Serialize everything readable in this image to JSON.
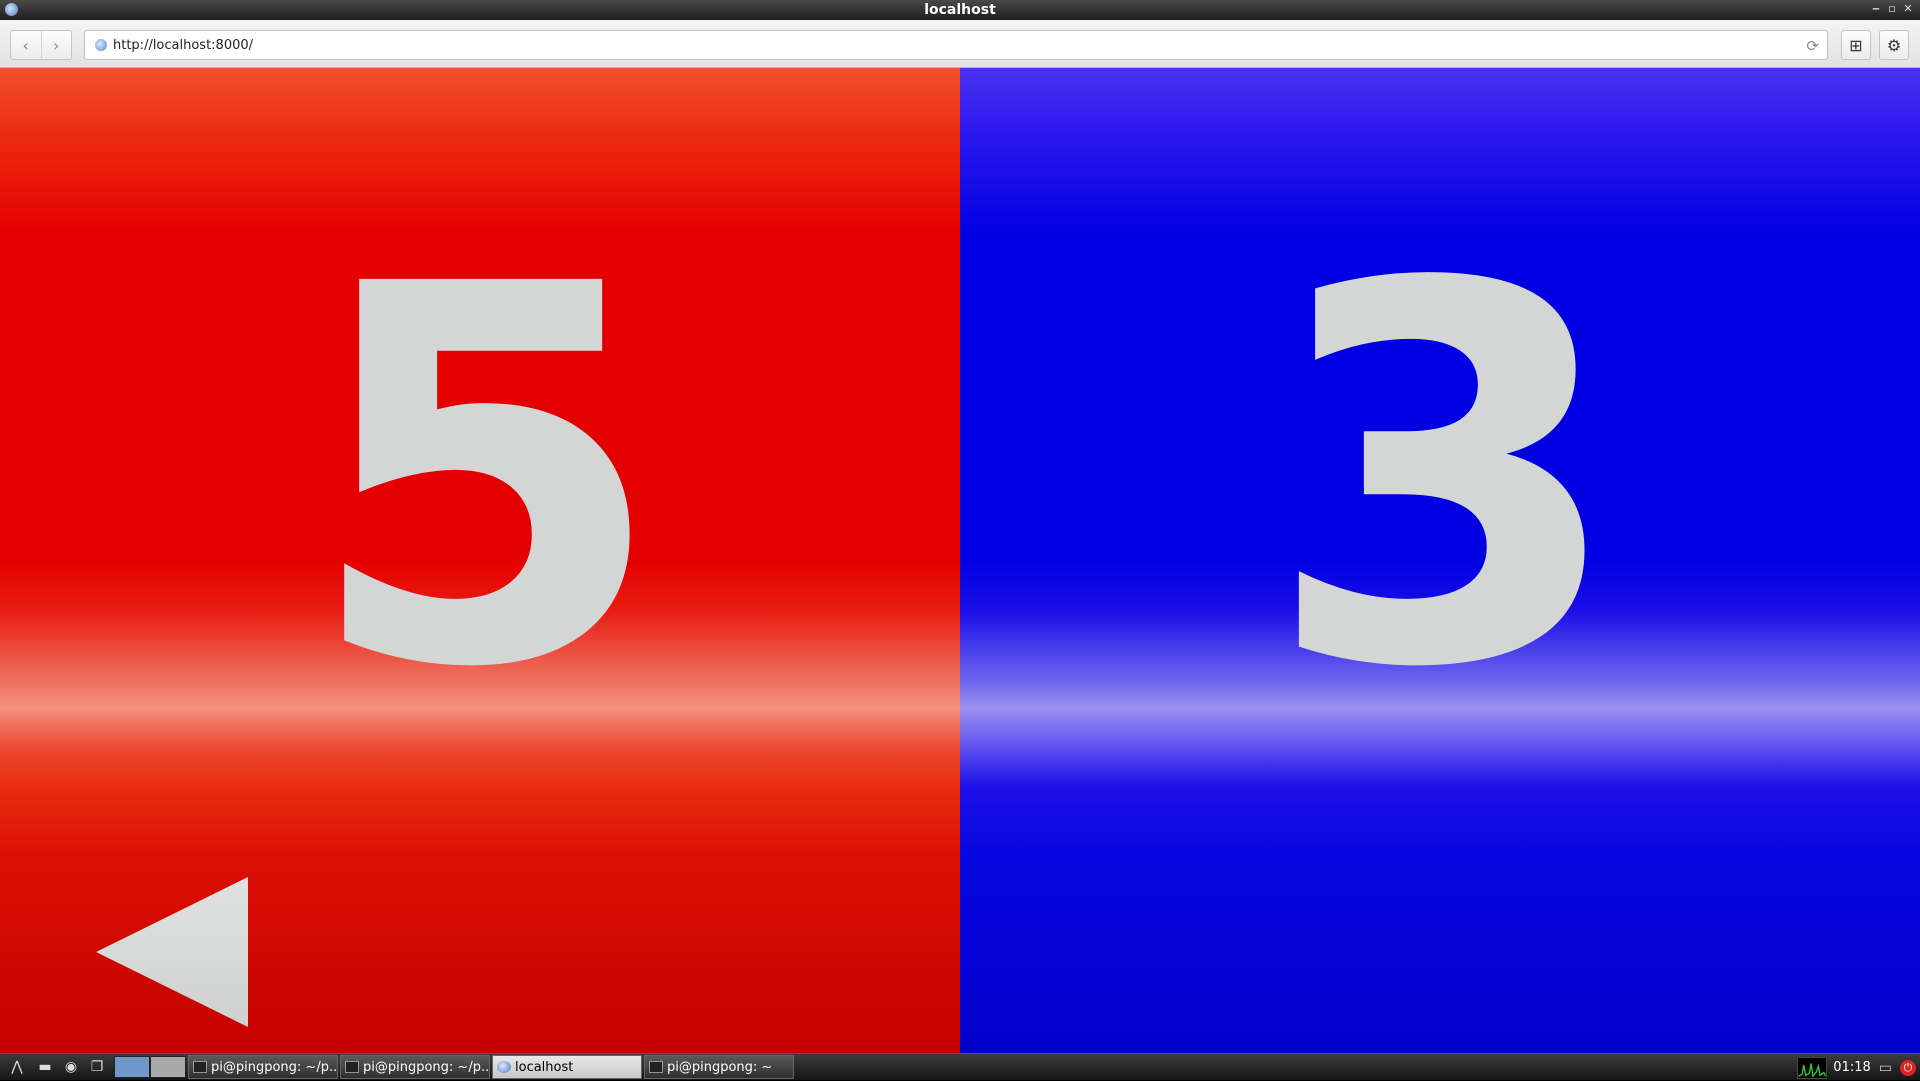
{
  "window": {
    "title": "localhost"
  },
  "toolbar": {
    "back_icon": "‹",
    "forward_icon": "›",
    "url": "http://localhost:8000/",
    "reload_icon": "⟳",
    "bookmark_icon": "⊞",
    "settings_icon": "⚙"
  },
  "scoreboard": {
    "left": {
      "score": "5",
      "color": "#e40000",
      "serving": true
    },
    "right": {
      "score": "3",
      "color": "#0000e2",
      "serving": false
    },
    "digit_color": "#d4d6d6"
  },
  "taskbar": {
    "tasks": [
      {
        "label": "pi@pingpong: ~/p...",
        "icon": "terminal-icon"
      },
      {
        "label": "pi@pingpong: ~/p...",
        "icon": "terminal-icon"
      },
      {
        "label": "localhost",
        "icon": "browser-icon",
        "active": true
      },
      {
        "label": "pi@pingpong: ~",
        "icon": "terminal-icon"
      }
    ],
    "clock": "01:18"
  }
}
